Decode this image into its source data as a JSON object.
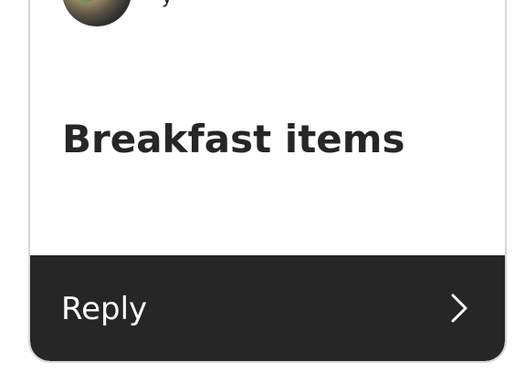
{
  "card": {
    "author_partial": "y ",
    "title": "Breakfast items"
  },
  "reply": {
    "label": "Reply"
  },
  "icons": {
    "avatar": "avatar",
    "chevron": "chevron-right-icon"
  },
  "colors": {
    "card_background": "#ffffff",
    "card_border": "#d6d6d6",
    "title_text": "#262626",
    "reply_bar_background": "#262626",
    "reply_text": "#ffffff"
  }
}
